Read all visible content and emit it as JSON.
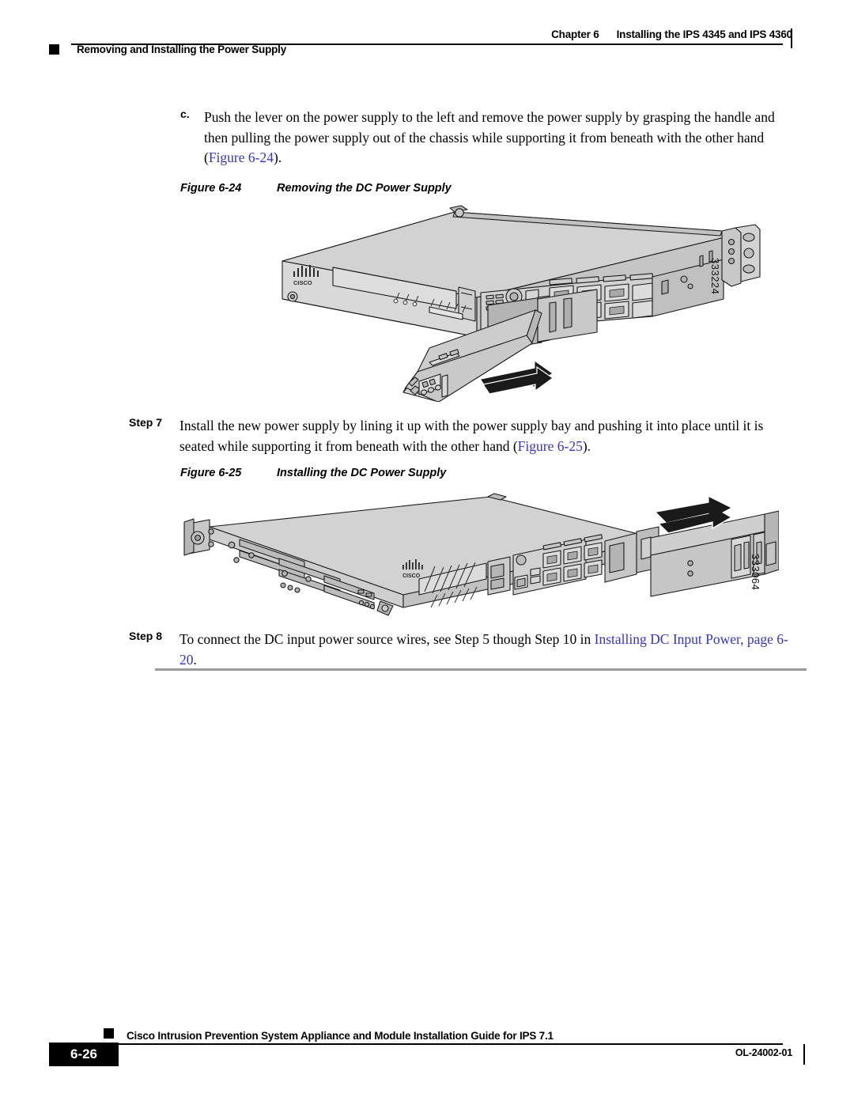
{
  "header": {
    "chapter_label": "Chapter 6",
    "chapter_title": "Installing the IPS 4345 and IPS 4360",
    "section_title": "Removing and Installing the Power Supply"
  },
  "body": {
    "substep_c": {
      "marker": "c.",
      "text_before_xref": "Push the lever on the power supply to the left and remove the power supply by grasping the handle and then pulling the power supply out of the chassis while supporting it from beneath with the other hand (",
      "xref": "Figure 6-24",
      "text_after_xref": ")."
    },
    "figure_24": {
      "caption_number": "Figure 6-24",
      "caption_title": "Removing the DC Power Supply",
      "art_id": "333224",
      "brand_label": "CISCO"
    },
    "step_7": {
      "label": "Step 7",
      "text_before_xref": "Install the new power supply by lining it up with the power supply bay and pushing it into place until it is seated while supporting it from beneath with the other hand (",
      "xref": "Figure 6-25",
      "text_after_xref": ")."
    },
    "figure_25": {
      "caption_number": "Figure 6-25",
      "caption_title": "Installing the DC Power Supply",
      "art_id": "333064",
      "brand_label": "CISCO"
    },
    "step_8": {
      "label": "Step 8",
      "text_before_xref": "To connect the DC input power source wires, see Step 5 though Step 10 in ",
      "xref": "Installing DC Input Power, page 6-20",
      "text_after_xref": "."
    }
  },
  "footer": {
    "guide_title": "Cisco Intrusion Prevention System Appliance and Module Installation Guide for IPS 7.1",
    "page_number": "6-26",
    "doc_number": "OL-24002-01"
  },
  "colors": {
    "text": "#000000",
    "xref_link": "#3333cc",
    "rule_gray": "#9a9a9a",
    "chassis_fill": "#d9d9d9",
    "chassis_top": "#cfcfcf",
    "chassis_dark": "#9a9a9a",
    "outline": "#1a1a1a"
  }
}
